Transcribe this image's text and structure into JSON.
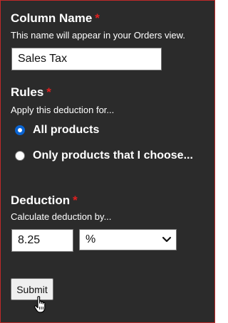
{
  "column_name": {
    "heading": "Column Name",
    "required_mark": "*",
    "hint": "This name will appear in your Orders view.",
    "value": "Sales Tax"
  },
  "rules": {
    "heading": "Rules",
    "required_mark": "*",
    "hint": "Apply this deduction for...",
    "options": [
      {
        "label": "All products",
        "selected": true
      },
      {
        "label": "Only products that I choose...",
        "selected": false
      }
    ]
  },
  "deduction": {
    "heading": "Deduction",
    "required_mark": "*",
    "hint": "Calculate deduction by...",
    "amount": "8.25",
    "unit": "%"
  },
  "submit_label": "Submit",
  "colors": {
    "background": "#2b2b2b",
    "border": "#c02a2a",
    "required": "#e02020",
    "radio_accent": "#0a64d2"
  },
  "icons": {
    "select_arrow": "chevron-down-icon",
    "pointer": "hand-pointer-icon"
  }
}
